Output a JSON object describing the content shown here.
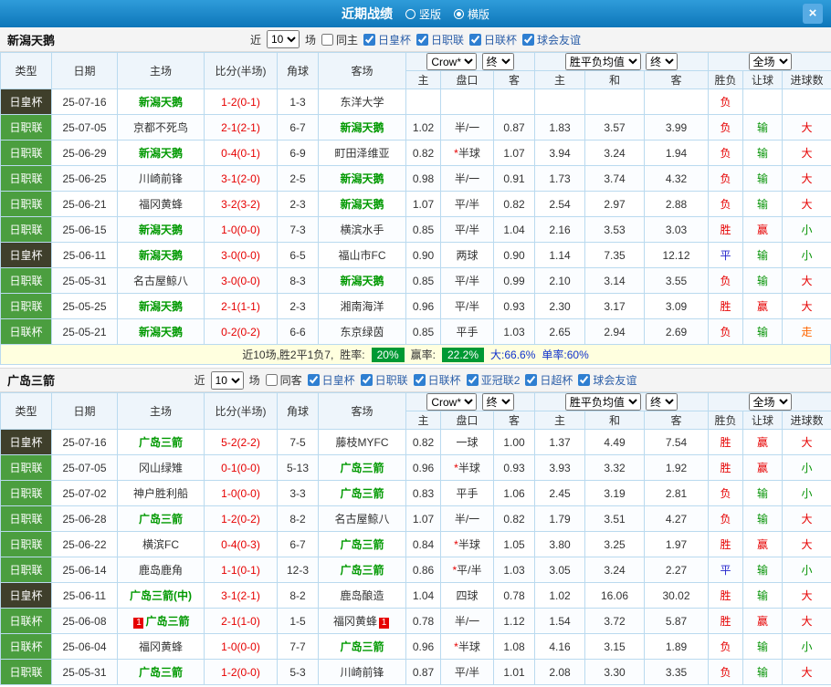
{
  "titlebar": {
    "title": "近期战绩",
    "layout_options": [
      {
        "label": "竖版",
        "selected": false
      },
      {
        "label": "横版",
        "selected": true
      }
    ],
    "close_label": "×"
  },
  "columns": {
    "type": "类型",
    "date": "日期",
    "home": "主场",
    "score": "比分(半场)",
    "corner": "角球",
    "away": "客场",
    "ah_home": "主",
    "ah_line": "盘口",
    "ah_away": "客",
    "eu_home": "主",
    "eu_draw": "和",
    "eu_away": "客",
    "result": "胜负",
    "handicap": "让球",
    "goals": "进球数"
  },
  "header_selects": {
    "bookmaker": "Crow*",
    "stage": "终",
    "odds_type": "胜平负均值",
    "scope": "全场"
  },
  "league_colors": {
    "日皇杯": "#3f3f2b",
    "日职联": "#4b9e3f",
    "日联杯": "#4b9e3f"
  },
  "status_colors": {
    "胜": "#e60000",
    "负": "#e60000",
    "平": "#2525cc",
    "赢": "#e60000",
    "输": "#089408",
    "走": "#ff6600",
    "大": "#e60000",
    "小": "#089408"
  },
  "text_colors": {
    "score": "#e60000",
    "subject_team": "#009900",
    "badge_bg": "#009933"
  },
  "sections": [
    {
      "name": "新潟天鹅",
      "filters": {
        "recent_label": "近",
        "recent_value": "10",
        "unit_label": "场",
        "same_venue": {
          "label": "同主",
          "checked": false
        },
        "leagues": [
          {
            "label": "日皇杯",
            "checked": true
          },
          {
            "label": "日职联",
            "checked": true
          },
          {
            "label": "日联杯",
            "checked": true
          },
          {
            "label": "球会友谊",
            "checked": true
          }
        ]
      },
      "rows": [
        {
          "league": "日皇杯",
          "date": "25-07-16",
          "home": {
            "name": "新潟天鹅",
            "subject": true
          },
          "score": "1-2(0-1)",
          "corner": "1-3",
          "away": {
            "name": "东洋大学"
          },
          "odds": [
            "",
            "",
            "",
            "",
            "",
            ""
          ],
          "results": [
            "负",
            "",
            ""
          ]
        },
        {
          "league": "日职联",
          "date": "25-07-05",
          "home": {
            "name": "京都不死鸟"
          },
          "score": "2-1(2-1)",
          "corner": "6-7",
          "away": {
            "name": "新潟天鹅",
            "subject": true
          },
          "odds": [
            "1.02",
            "半/一",
            "0.87",
            "1.83",
            "3.57",
            "3.99"
          ],
          "results": [
            "负",
            "输",
            "大"
          ]
        },
        {
          "league": "日职联",
          "date": "25-06-29",
          "home": {
            "name": "新潟天鹅",
            "subject": true
          },
          "score": "0-4(0-1)",
          "corner": "6-9",
          "away": {
            "name": "町田泽维亚"
          },
          "odds": [
            "0.82",
            "*半球",
            "1.07",
            "3.94",
            "3.24",
            "1.94"
          ],
          "results": [
            "负",
            "输",
            "大"
          ]
        },
        {
          "league": "日职联",
          "date": "25-06-25",
          "home": {
            "name": "川崎前锋"
          },
          "score": "3-1(2-0)",
          "corner": "2-5",
          "away": {
            "name": "新潟天鹅",
            "subject": true
          },
          "odds": [
            "0.98",
            "半/一",
            "0.91",
            "1.73",
            "3.74",
            "4.32"
          ],
          "results": [
            "负",
            "输",
            "大"
          ]
        },
        {
          "league": "日职联",
          "date": "25-06-21",
          "home": {
            "name": "福冈黄蜂"
          },
          "score": "3-2(3-2)",
          "corner": "2-3",
          "away": {
            "name": "新潟天鹅",
            "subject": true
          },
          "odds": [
            "1.07",
            "平/半",
            "0.82",
            "2.54",
            "2.97",
            "2.88"
          ],
          "results": [
            "负",
            "输",
            "大"
          ]
        },
        {
          "league": "日职联",
          "date": "25-06-15",
          "home": {
            "name": "新潟天鹅",
            "subject": true
          },
          "score": "1-0(0-0)",
          "corner": "7-3",
          "away": {
            "name": "横滨水手"
          },
          "odds": [
            "0.85",
            "平/半",
            "1.04",
            "2.16",
            "3.53",
            "3.03"
          ],
          "results": [
            "胜",
            "赢",
            "小"
          ]
        },
        {
          "league": "日皇杯",
          "date": "25-06-11",
          "home": {
            "name": "新潟天鹅",
            "subject": true
          },
          "score": "3-0(0-0)",
          "corner": "6-5",
          "away": {
            "name": "福山市FC"
          },
          "odds": [
            "0.90",
            "两球",
            "0.90",
            "1.14",
            "7.35",
            "12.12"
          ],
          "results": [
            "平",
            "输",
            "小"
          ]
        },
        {
          "league": "日职联",
          "date": "25-05-31",
          "home": {
            "name": "名古屋鲸八"
          },
          "score": "3-0(0-0)",
          "corner": "8-3",
          "away": {
            "name": "新潟天鹅",
            "subject": true
          },
          "odds": [
            "0.85",
            "平/半",
            "0.99",
            "2.10",
            "3.14",
            "3.55"
          ],
          "results": [
            "负",
            "输",
            "大"
          ]
        },
        {
          "league": "日职联",
          "date": "25-05-25",
          "home": {
            "name": "新潟天鹅",
            "subject": true
          },
          "score": "2-1(1-1)",
          "corner": "2-3",
          "away": {
            "name": "湘南海洋"
          },
          "odds": [
            "0.96",
            "平/半",
            "0.93",
            "2.30",
            "3.17",
            "3.09"
          ],
          "results": [
            "胜",
            "赢",
            "大"
          ]
        },
        {
          "league": "日联杯",
          "date": "25-05-21",
          "home": {
            "name": "新潟天鹅",
            "subject": true
          },
          "score": "0-2(0-2)",
          "corner": "6-6",
          "away": {
            "name": "东京绿茵"
          },
          "odds": [
            "0.85",
            "平手",
            "1.03",
            "2.65",
            "2.94",
            "2.69"
          ],
          "results": [
            "负",
            "输",
            "走"
          ]
        }
      ],
      "summary": {
        "record": "近10场,胜2平1负7,",
        "win_rate_label": "胜率:",
        "win_rate": "20%",
        "cover_rate_label": "赢率:",
        "cover_rate": "22.2%",
        "over_rate": "大:66.6%",
        "odd_rate": "单率:60%"
      }
    },
    {
      "name": "广岛三箭",
      "filters": {
        "recent_label": "近",
        "recent_value": "10",
        "unit_label": "场",
        "same_venue": {
          "label": "同客",
          "checked": false
        },
        "leagues": [
          {
            "label": "日皇杯",
            "checked": true
          },
          {
            "label": "日职联",
            "checked": true
          },
          {
            "label": "日联杯",
            "checked": true
          },
          {
            "label": "亚冠联2",
            "checked": true
          },
          {
            "label": "日超杯",
            "checked": true
          },
          {
            "label": "球会友谊",
            "checked": true
          }
        ]
      },
      "rows": [
        {
          "league": "日皇杯",
          "date": "25-07-16",
          "home": {
            "name": "广岛三箭",
            "subject": true
          },
          "score": "5-2(2-2)",
          "corner": "7-5",
          "away": {
            "name": "藤枝MYFC"
          },
          "odds": [
            "0.82",
            "一球",
            "1.00",
            "1.37",
            "4.49",
            "7.54"
          ],
          "results": [
            "胜",
            "赢",
            "大"
          ]
        },
        {
          "league": "日职联",
          "date": "25-07-05",
          "home": {
            "name": "冈山绿雉"
          },
          "score": "0-1(0-0)",
          "corner": "5-13",
          "away": {
            "name": "广岛三箭",
            "subject": true
          },
          "odds": [
            "0.96",
            "*半球",
            "0.93",
            "3.93",
            "3.32",
            "1.92"
          ],
          "results": [
            "胜",
            "赢",
            "小"
          ]
        },
        {
          "league": "日职联",
          "date": "25-07-02",
          "home": {
            "name": "神户胜利船"
          },
          "score": "1-0(0-0)",
          "corner": "3-3",
          "away": {
            "name": "广岛三箭",
            "subject": true
          },
          "odds": [
            "0.83",
            "平手",
            "1.06",
            "2.45",
            "3.19",
            "2.81"
          ],
          "results": [
            "负",
            "输",
            "小"
          ]
        },
        {
          "league": "日职联",
          "date": "25-06-28",
          "home": {
            "name": "广岛三箭",
            "subject": true
          },
          "score": "1-2(0-2)",
          "corner": "8-2",
          "away": {
            "name": "名古屋鲸八"
          },
          "odds": [
            "1.07",
            "半/一",
            "0.82",
            "1.79",
            "3.51",
            "4.27"
          ],
          "results": [
            "负",
            "输",
            "大"
          ]
        },
        {
          "league": "日职联",
          "date": "25-06-22",
          "home": {
            "name": "横滨FC"
          },
          "score": "0-4(0-3)",
          "corner": "6-7",
          "away": {
            "name": "广岛三箭",
            "subject": true
          },
          "odds": [
            "0.84",
            "*半球",
            "1.05",
            "3.80",
            "3.25",
            "1.97"
          ],
          "results": [
            "胜",
            "赢",
            "大"
          ]
        },
        {
          "league": "日职联",
          "date": "25-06-14",
          "home": {
            "name": "鹿岛鹿角"
          },
          "score": "1-1(0-1)",
          "corner": "12-3",
          "away": {
            "name": "广岛三箭",
            "subject": true
          },
          "odds": [
            "0.86",
            "*平/半",
            "1.03",
            "3.05",
            "3.24",
            "2.27"
          ],
          "results": [
            "平",
            "输",
            "小"
          ]
        },
        {
          "league": "日皇杯",
          "date": "25-06-11",
          "home": {
            "name": "广岛三箭(中)",
            "subject": true
          },
          "score": "3-1(2-1)",
          "corner": "8-2",
          "away": {
            "name": "鹿岛酿造"
          },
          "odds": [
            "1.04",
            "四球",
            "0.78",
            "1.02",
            "16.06",
            "30.02"
          ],
          "results": [
            "胜",
            "输",
            "大"
          ]
        },
        {
          "league": "日联杯",
          "date": "25-06-08",
          "home": {
            "name": "广岛三箭",
            "subject": true,
            "card": "1"
          },
          "score": "2-1(1-0)",
          "corner": "1-5",
          "away": {
            "name": "福冈黄蜂",
            "card": "1"
          },
          "odds": [
            "0.78",
            "半/一",
            "1.12",
            "1.54",
            "3.72",
            "5.87"
          ],
          "results": [
            "胜",
            "赢",
            "大"
          ]
        },
        {
          "league": "日联杯",
          "date": "25-06-04",
          "home": {
            "name": "福冈黄蜂"
          },
          "score": "1-0(0-0)",
          "corner": "7-7",
          "away": {
            "name": "广岛三箭",
            "subject": true
          },
          "odds": [
            "0.96",
            "*半球",
            "1.08",
            "4.16",
            "3.15",
            "1.89"
          ],
          "results": [
            "负",
            "输",
            "小"
          ]
        },
        {
          "league": "日职联",
          "date": "25-05-31",
          "home": {
            "name": "广岛三箭",
            "subject": true
          },
          "score": "1-2(0-0)",
          "corner": "5-3",
          "away": {
            "name": "川崎前锋"
          },
          "odds": [
            "0.87",
            "平/半",
            "1.01",
            "2.08",
            "3.30",
            "3.35"
          ],
          "results": [
            "负",
            "输",
            "大"
          ]
        }
      ]
    }
  ]
}
